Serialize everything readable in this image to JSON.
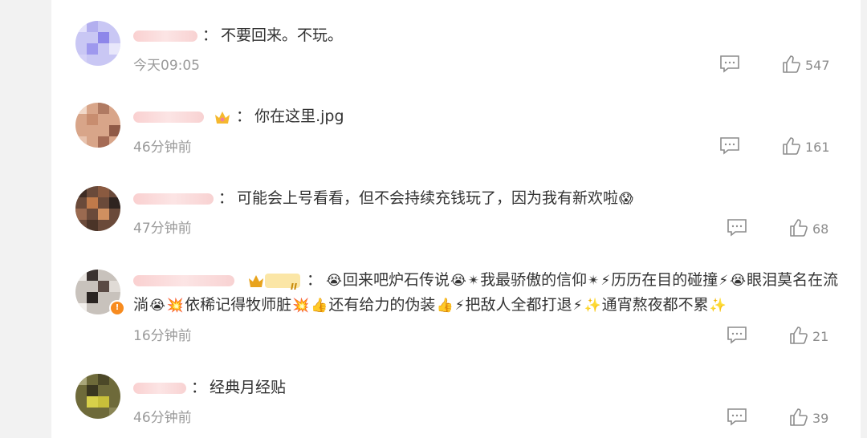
{
  "comments": [
    {
      "text": "不要回来。不玩。",
      "time": "今天09:05",
      "likes": "547"
    },
    {
      "text": "你在这里.jpg",
      "time": "46分钟前",
      "likes": "161"
    },
    {
      "text": "可能会上号看看，但不会持续充钱玩了，因为我有新欢啦",
      "time": "47分钟前",
      "likes": "68"
    },
    {
      "parts": [
        "回来吧炉石传说",
        "我最骄傲的信仰",
        "历历在目的碰撞",
        "眼泪莫名在流淌",
        "依稀记得牧师脏",
        "还有给力的伪装",
        "把敌人全都打退",
        "通宵熬夜都不累"
      ],
      "level_badge": "II",
      "time": "16分钟前",
      "likes": "21"
    },
    {
      "text": "经典月经贴",
      "time": "46分钟前",
      "likes": "39"
    }
  ],
  "colon": "：",
  "emoji": {
    "cry": "😭",
    "scream": "😱",
    "burst": "💥",
    "sparkle": "✨",
    "star": "✴",
    "thumbs": "👍",
    "bolt": "⚡",
    "crown": "👑"
  },
  "colors": {
    "background": "#f2f2f2",
    "panel": "#ffffff",
    "text": "#333333",
    "meta": "#9a9a9a",
    "icon": "#8c8c8c"
  }
}
